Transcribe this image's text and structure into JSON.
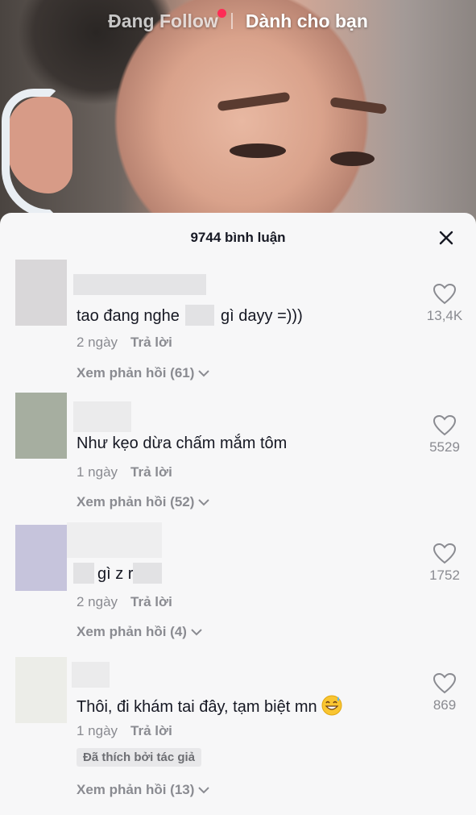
{
  "top_nav": {
    "following": "Đang Follow",
    "for_you": "Dành cho bạn"
  },
  "sheet": {
    "title": "9744 bình luận"
  },
  "comments": [
    {
      "text_before": "tao đang nghe",
      "text_after": "gì dayy =)))",
      "date": "2 ngày",
      "reply": "Trả lời",
      "view_replies": "Xem phản hồi (61)",
      "likes": "13,4K",
      "avatar_color": "#d9d7d9"
    },
    {
      "text": "Như kẹo dừa chấm mắm tôm",
      "date": "1 ngày",
      "reply": "Trả lời",
      "view_replies": "Xem phản hồi (52)",
      "likes": "5529",
      "avatar_color": "#a6aea0"
    },
    {
      "text_middle": "gì z r",
      "date": "2 ngày",
      "reply": "Trả lời",
      "view_replies": "Xem phản hồi (4)",
      "likes": "1752",
      "avatar_color": "#c6c4dc"
    },
    {
      "text": "Thôi, đi khám tai đây, tạm biệt mn",
      "date": "1 ngày",
      "reply": "Trả lời",
      "liked_by_creator": "Đã thích bởi tác giả",
      "view_replies": "Xem phản hồi (13)",
      "likes": "869",
      "avatar_color": "#ecede8"
    }
  ]
}
